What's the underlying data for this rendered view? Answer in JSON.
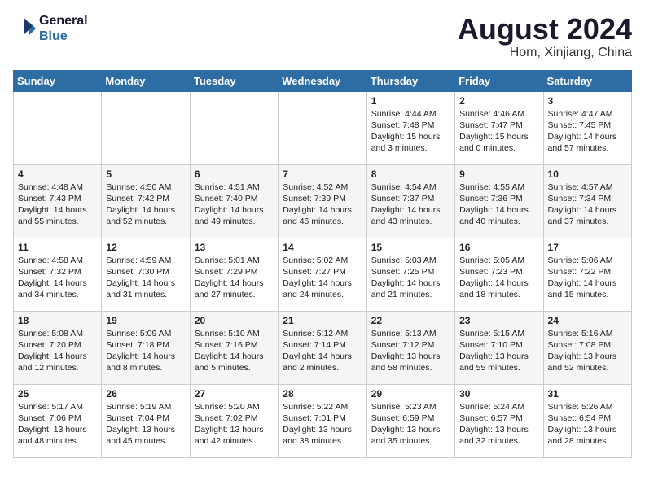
{
  "header": {
    "logo_line1": "General",
    "logo_line2": "Blue",
    "month_year": "August 2024",
    "location": "Hom, Xinjiang, China"
  },
  "days_of_week": [
    "Sunday",
    "Monday",
    "Tuesday",
    "Wednesday",
    "Thursday",
    "Friday",
    "Saturday"
  ],
  "weeks": [
    [
      {
        "day": "",
        "content": ""
      },
      {
        "day": "",
        "content": ""
      },
      {
        "day": "",
        "content": ""
      },
      {
        "day": "",
        "content": ""
      },
      {
        "day": "1",
        "content": "Sunrise: 4:44 AM\nSunset: 7:48 PM\nDaylight: 15 hours\nand 3 minutes."
      },
      {
        "day": "2",
        "content": "Sunrise: 4:46 AM\nSunset: 7:47 PM\nDaylight: 15 hours\nand 0 minutes."
      },
      {
        "day": "3",
        "content": "Sunrise: 4:47 AM\nSunset: 7:45 PM\nDaylight: 14 hours\nand 57 minutes."
      }
    ],
    [
      {
        "day": "4",
        "content": "Sunrise: 4:48 AM\nSunset: 7:43 PM\nDaylight: 14 hours\nand 55 minutes."
      },
      {
        "day": "5",
        "content": "Sunrise: 4:50 AM\nSunset: 7:42 PM\nDaylight: 14 hours\nand 52 minutes."
      },
      {
        "day": "6",
        "content": "Sunrise: 4:51 AM\nSunset: 7:40 PM\nDaylight: 14 hours\nand 49 minutes."
      },
      {
        "day": "7",
        "content": "Sunrise: 4:52 AM\nSunset: 7:39 PM\nDaylight: 14 hours\nand 46 minutes."
      },
      {
        "day": "8",
        "content": "Sunrise: 4:54 AM\nSunset: 7:37 PM\nDaylight: 14 hours\nand 43 minutes."
      },
      {
        "day": "9",
        "content": "Sunrise: 4:55 AM\nSunset: 7:36 PM\nDaylight: 14 hours\nand 40 minutes."
      },
      {
        "day": "10",
        "content": "Sunrise: 4:57 AM\nSunset: 7:34 PM\nDaylight: 14 hours\nand 37 minutes."
      }
    ],
    [
      {
        "day": "11",
        "content": "Sunrise: 4:58 AM\nSunset: 7:32 PM\nDaylight: 14 hours\nand 34 minutes."
      },
      {
        "day": "12",
        "content": "Sunrise: 4:59 AM\nSunset: 7:30 PM\nDaylight: 14 hours\nand 31 minutes."
      },
      {
        "day": "13",
        "content": "Sunrise: 5:01 AM\nSunset: 7:29 PM\nDaylight: 14 hours\nand 27 minutes."
      },
      {
        "day": "14",
        "content": "Sunrise: 5:02 AM\nSunset: 7:27 PM\nDaylight: 14 hours\nand 24 minutes."
      },
      {
        "day": "15",
        "content": "Sunrise: 5:03 AM\nSunset: 7:25 PM\nDaylight: 14 hours\nand 21 minutes."
      },
      {
        "day": "16",
        "content": "Sunrise: 5:05 AM\nSunset: 7:23 PM\nDaylight: 14 hours\nand 18 minutes."
      },
      {
        "day": "17",
        "content": "Sunrise: 5:06 AM\nSunset: 7:22 PM\nDaylight: 14 hours\nand 15 minutes."
      }
    ],
    [
      {
        "day": "18",
        "content": "Sunrise: 5:08 AM\nSunset: 7:20 PM\nDaylight: 14 hours\nand 12 minutes."
      },
      {
        "day": "19",
        "content": "Sunrise: 5:09 AM\nSunset: 7:18 PM\nDaylight: 14 hours\nand 8 minutes."
      },
      {
        "day": "20",
        "content": "Sunrise: 5:10 AM\nSunset: 7:16 PM\nDaylight: 14 hours\nand 5 minutes."
      },
      {
        "day": "21",
        "content": "Sunrise: 5:12 AM\nSunset: 7:14 PM\nDaylight: 14 hours\nand 2 minutes."
      },
      {
        "day": "22",
        "content": "Sunrise: 5:13 AM\nSunset: 7:12 PM\nDaylight: 13 hours\nand 58 minutes."
      },
      {
        "day": "23",
        "content": "Sunrise: 5:15 AM\nSunset: 7:10 PM\nDaylight: 13 hours\nand 55 minutes."
      },
      {
        "day": "24",
        "content": "Sunrise: 5:16 AM\nSunset: 7:08 PM\nDaylight: 13 hours\nand 52 minutes."
      }
    ],
    [
      {
        "day": "25",
        "content": "Sunrise: 5:17 AM\nSunset: 7:06 PM\nDaylight: 13 hours\nand 48 minutes."
      },
      {
        "day": "26",
        "content": "Sunrise: 5:19 AM\nSunset: 7:04 PM\nDaylight: 13 hours\nand 45 minutes."
      },
      {
        "day": "27",
        "content": "Sunrise: 5:20 AM\nSunset: 7:02 PM\nDaylight: 13 hours\nand 42 minutes."
      },
      {
        "day": "28",
        "content": "Sunrise: 5:22 AM\nSunset: 7:01 PM\nDaylight: 13 hours\nand 38 minutes."
      },
      {
        "day": "29",
        "content": "Sunrise: 5:23 AM\nSunset: 6:59 PM\nDaylight: 13 hours\nand 35 minutes."
      },
      {
        "day": "30",
        "content": "Sunrise: 5:24 AM\nSunset: 6:57 PM\nDaylight: 13 hours\nand 32 minutes."
      },
      {
        "day": "31",
        "content": "Sunrise: 5:26 AM\nSunset: 6:54 PM\nDaylight: 13 hours\nand 28 minutes."
      }
    ]
  ]
}
